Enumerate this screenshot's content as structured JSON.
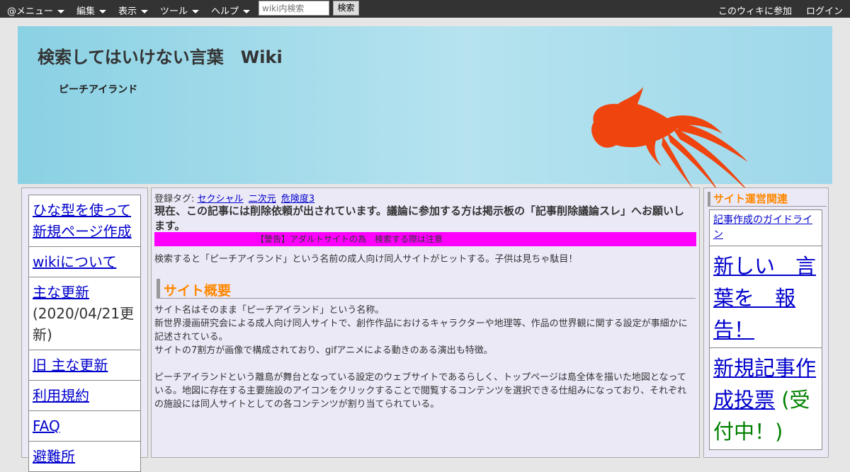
{
  "topbar": {
    "menu_label": "@メニュー",
    "edit_label": "編集",
    "view_label": "表示",
    "tools_label": "ツール",
    "help_label": "ヘルプ",
    "search_placeholder": "wiki内検索",
    "search_button": "検索",
    "join_label": "このウィキに参加",
    "login_label": "ログイン"
  },
  "header": {
    "site_title": "検索してはいけない言葉　Wiki",
    "page_name": "ピーチアイランド",
    "fish_color": "#f0440e"
  },
  "left_nav": {
    "items": [
      {
        "label": "ひな型を使って新規ページ作成"
      },
      {
        "label": "wikiについて"
      },
      {
        "label": "主な更新",
        "sub": "(2020/04/21更新)"
      },
      {
        "label": "旧 主な更新"
      },
      {
        "label": "利用規約"
      },
      {
        "label": "FAQ"
      },
      {
        "label": "避難所"
      }
    ]
  },
  "main": {
    "tags_label": "登録タグ:",
    "tags": [
      "セクシャル",
      "二次元",
      "危険度3"
    ],
    "deletion_notice": "現在、この記事には削除依頼が出されています。議論に参加する方は掲示板の「記事削除議論スレ」へお願いします。",
    "warning": "【警告】アダルトサイトの為　検索する際は注意",
    "warning_color": "#ff00ff",
    "intro": "検索すると「ピーチアイランド」という名前の成人向け同人サイトがヒットする。子供は見ちゃ駄目！",
    "section_title": "サイト概要",
    "paragraph1_line1": "サイト名はそのまま「ピーチアイランド」という名称。",
    "paragraph1_line2": "新世界漫画研究会による成人向け同人サイトで、創作作品におけるキャラクターや地理等、作品の世界観に関する設定が事細かに記述されている。",
    "paragraph1_line3": "サイトの7割方が画像で構成されており、gifアニメによる動きのある演出も特徴。",
    "paragraph2": "ピーチアイランドという離島が舞台となっている設定のウェブサイトであるらしく、トップページは島全体を描いた地図となっている。地図に存在する主要施設のアイコンをクリックすることで閲覧するコンテンツを選択できる仕組みになっており、それぞれの施設には同人サイトとしての各コンテンツが割り当てられている。"
  },
  "right_nav": {
    "heading": "サイト運営関連",
    "guideline_link": "記事作成のガイドライン",
    "report_link": "新しい　言葉を　報告！",
    "vote_link": "新規記事作成投票",
    "vote_status": "(受付中！)"
  }
}
